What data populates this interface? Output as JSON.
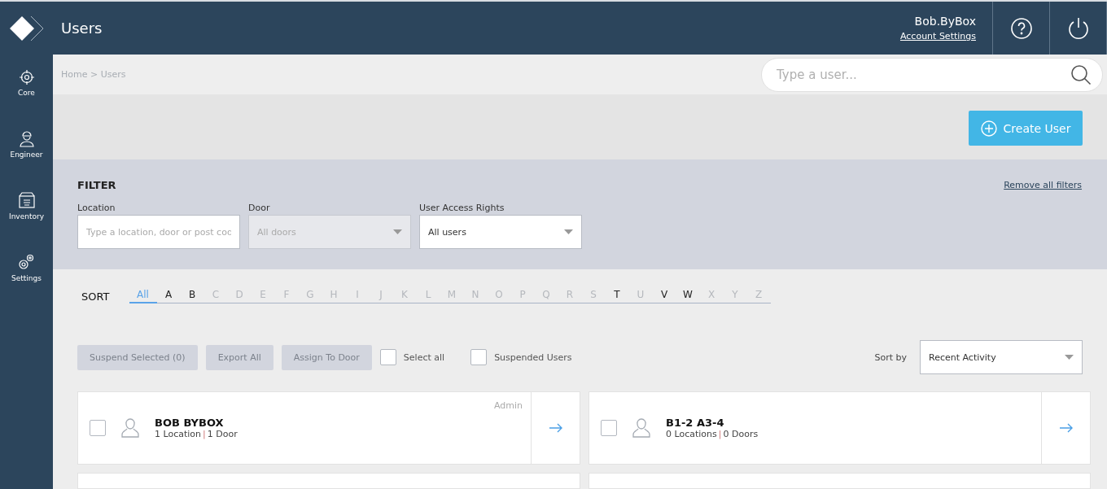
{
  "header": {
    "title": "Users",
    "user_name": "Bob.ByBox",
    "account_link": "Account Settings"
  },
  "sidebar": {
    "items": [
      {
        "label": "Core",
        "kind": "core"
      },
      {
        "label": "Engineer",
        "kind": "engineer"
      },
      {
        "label": "Inventory",
        "kind": "inventory"
      },
      {
        "label": "Settings",
        "kind": "settings"
      }
    ]
  },
  "breadcrumb": "Home > Users",
  "search": {
    "placeholder": "Type a user..."
  },
  "create_button": "Create User",
  "filter": {
    "title": "FILTER",
    "remove_link": "Remove all filters",
    "location": {
      "label": "Location",
      "placeholder": "Type a location, door or post cod"
    },
    "door": {
      "label": "Door",
      "value": "All doors",
      "disabled": true
    },
    "access": {
      "label": "User Access Rights",
      "value": "All users",
      "disabled": false
    }
  },
  "sort": {
    "title": "SORT",
    "letters": [
      {
        "label": "All",
        "selected": true,
        "enabled": true
      },
      {
        "label": "A",
        "selected": false,
        "enabled": true
      },
      {
        "label": "B",
        "selected": false,
        "enabled": true
      },
      {
        "label": "C",
        "selected": false,
        "enabled": false
      },
      {
        "label": "D",
        "selected": false,
        "enabled": false
      },
      {
        "label": "E",
        "selected": false,
        "enabled": false
      },
      {
        "label": "F",
        "selected": false,
        "enabled": false
      },
      {
        "label": "G",
        "selected": false,
        "enabled": false
      },
      {
        "label": "H",
        "selected": false,
        "enabled": false
      },
      {
        "label": "I",
        "selected": false,
        "enabled": false
      },
      {
        "label": "J",
        "selected": false,
        "enabled": false
      },
      {
        "label": "K",
        "selected": false,
        "enabled": false
      },
      {
        "label": "L",
        "selected": false,
        "enabled": false
      },
      {
        "label": "M",
        "selected": false,
        "enabled": false
      },
      {
        "label": "N",
        "selected": false,
        "enabled": false
      },
      {
        "label": "O",
        "selected": false,
        "enabled": false
      },
      {
        "label": "P",
        "selected": false,
        "enabled": false
      },
      {
        "label": "Q",
        "selected": false,
        "enabled": false
      },
      {
        "label": "R",
        "selected": false,
        "enabled": false
      },
      {
        "label": "S",
        "selected": false,
        "enabled": false
      },
      {
        "label": "T",
        "selected": false,
        "enabled": true
      },
      {
        "label": "U",
        "selected": false,
        "enabled": false
      },
      {
        "label": "V",
        "selected": false,
        "enabled": true
      },
      {
        "label": "W",
        "selected": false,
        "enabled": true
      },
      {
        "label": "X",
        "selected": false,
        "enabled": false
      },
      {
        "label": "Y",
        "selected": false,
        "enabled": false
      },
      {
        "label": "Z",
        "selected": false,
        "enabled": false
      }
    ]
  },
  "actions": {
    "buttons": [
      "Suspend Selected (0)",
      "Export All",
      "Assign To Door"
    ],
    "checks": [
      {
        "label": "Select all",
        "checked": false
      },
      {
        "label": "Suspended Users",
        "checked": false
      }
    ],
    "sort_by_label": "Sort by",
    "sort_by_value": "Recent Activity"
  },
  "users": [
    {
      "name": "BOB BYBOX",
      "role": "Admin",
      "locations": "1 Location",
      "doors": "1 Door",
      "separator": "|",
      "checked": false
    },
    {
      "name": "B1-2 A3-4",
      "locations": "0 Locations",
      "doors": "0 Doors",
      "separator": "|",
      "checked": false
    }
  ]
}
